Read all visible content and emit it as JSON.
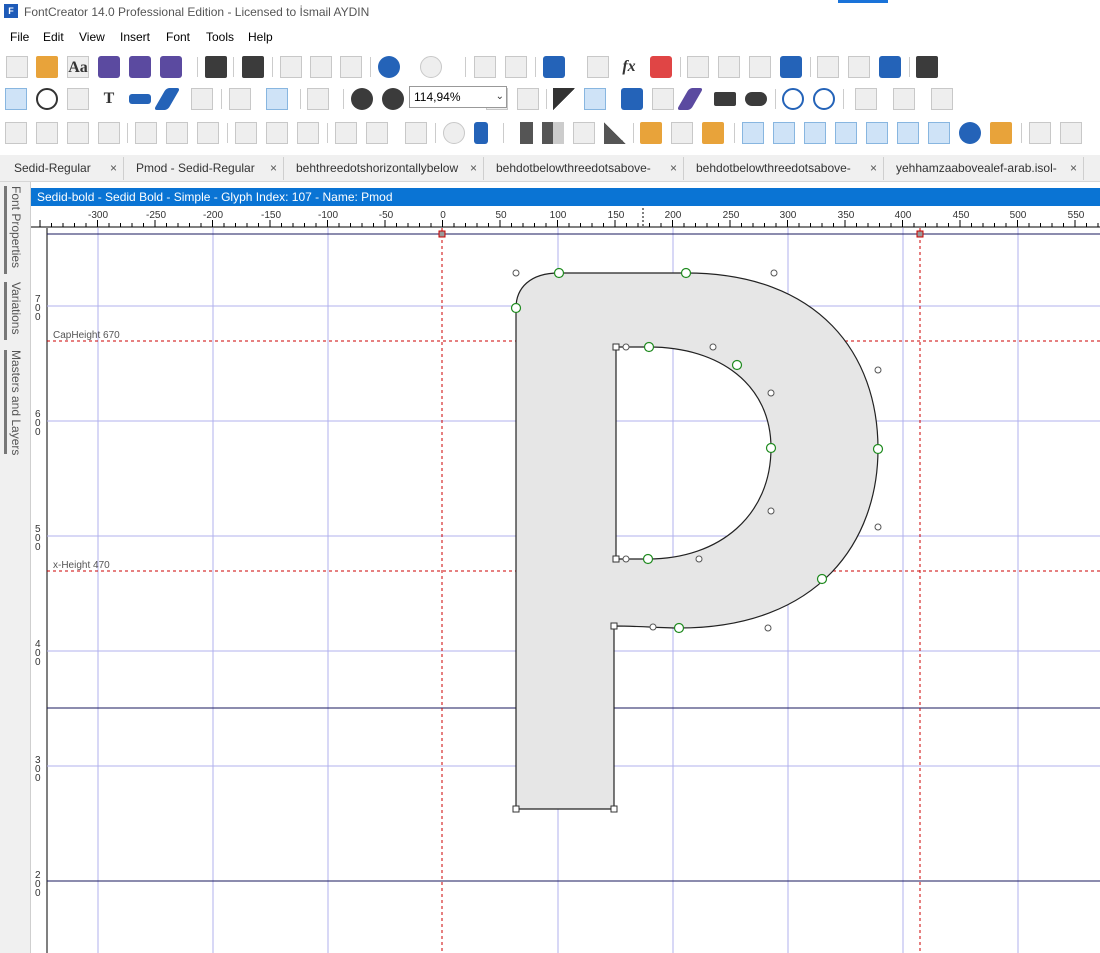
{
  "window": {
    "title": "FontCreator 14.0 Professional Edition - Licensed to İsmail AYDIN",
    "app_icon": "F"
  },
  "menu": [
    "File",
    "Edit",
    "View",
    "Insert",
    "Font",
    "Tools",
    "Help"
  ],
  "toolbar": {
    "zoom_value": "114,94%"
  },
  "tabs": [
    {
      "label": "Sedid-Regular"
    },
    {
      "label": "Pmod - Sedid-Regular"
    },
    {
      "label": "behthreedotshorizontallybelow"
    },
    {
      "label": "behdotbelowthreedotsabove-"
    },
    {
      "label": "behdotbelowthreedotsabove-"
    },
    {
      "label": "yehhamzaabovealef-arab.isol-"
    }
  ],
  "side_panels": [
    "Font Properties",
    "Variations",
    "Masters and Layers"
  ],
  "glyph_header": "Sedid-bold - Sedid Bold - Simple - Glyph Index: 107 - Name: Pmod",
  "ruler": {
    "x_ticks": [
      "-300",
      "-250",
      "-200",
      "-150",
      "-100",
      "-50",
      "0",
      "50",
      "100",
      "150",
      "200",
      "250",
      "300",
      "350",
      "400",
      "450",
      "500",
      "550"
    ],
    "y_ticks": [
      "700",
      "600",
      "500",
      "400",
      "300",
      "200"
    ]
  },
  "guides": {
    "cap_height": "CapHeight 670",
    "x_height": "x-Height 470"
  },
  "colors": {
    "accent": "#0a74d4",
    "grid": "#b0b0ee",
    "guide": "#cc0000",
    "glyph_fill": "#e6e6e6",
    "point_green": "#1e8a1e"
  }
}
